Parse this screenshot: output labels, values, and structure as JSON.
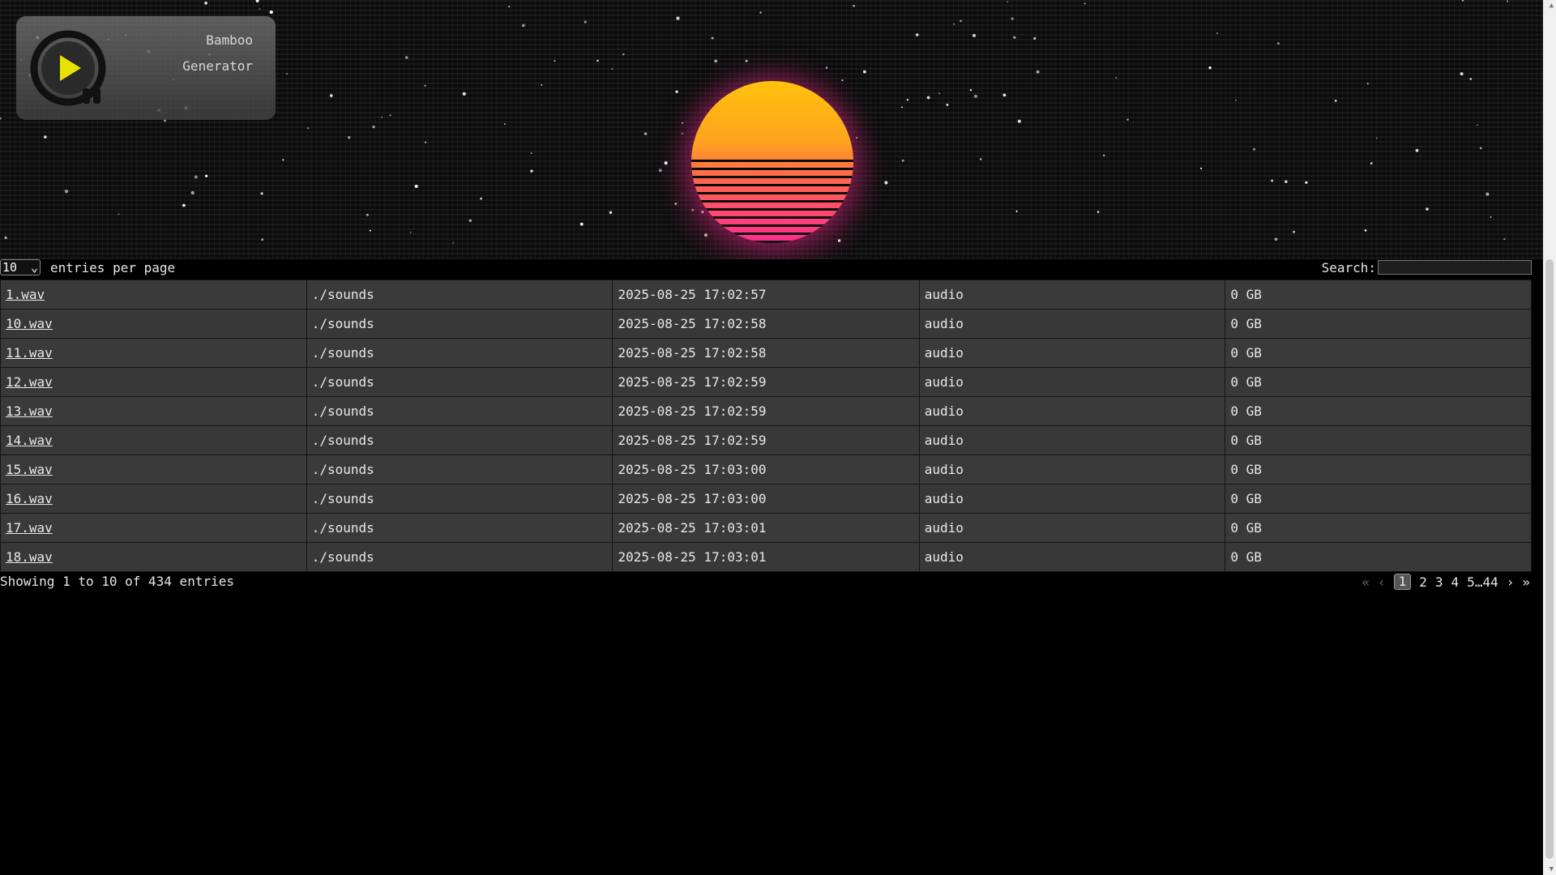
{
  "logo": {
    "line1": "Bamboo",
    "line2": "Generator",
    "icon": "play-circle-pause-icon"
  },
  "length": {
    "value": "10",
    "label": "entries per page"
  },
  "search": {
    "label": "Search:",
    "value": ""
  },
  "table": {
    "rows": [
      {
        "name": "1.wav",
        "path": "./sounds",
        "date": "2025-08-25 17:02:57",
        "type": "audio",
        "size": "0 GB"
      },
      {
        "name": "10.wav",
        "path": "./sounds",
        "date": "2025-08-25 17:02:58",
        "type": "audio",
        "size": "0 GB"
      },
      {
        "name": "11.wav",
        "path": "./sounds",
        "date": "2025-08-25 17:02:58",
        "type": "audio",
        "size": "0 GB"
      },
      {
        "name": "12.wav",
        "path": "./sounds",
        "date": "2025-08-25 17:02:59",
        "type": "audio",
        "size": "0 GB"
      },
      {
        "name": "13.wav",
        "path": "./sounds",
        "date": "2025-08-25 17:02:59",
        "type": "audio",
        "size": "0 GB"
      },
      {
        "name": "14.wav",
        "path": "./sounds",
        "date": "2025-08-25 17:02:59",
        "type": "audio",
        "size": "0 GB"
      },
      {
        "name": "15.wav",
        "path": "./sounds",
        "date": "2025-08-25 17:03:00",
        "type": "audio",
        "size": "0 GB"
      },
      {
        "name": "16.wav",
        "path": "./sounds",
        "date": "2025-08-25 17:03:00",
        "type": "audio",
        "size": "0 GB"
      },
      {
        "name": "17.wav",
        "path": "./sounds",
        "date": "2025-08-25 17:03:01",
        "type": "audio",
        "size": "0 GB"
      },
      {
        "name": "18.wav",
        "path": "./sounds",
        "date": "2025-08-25 17:03:01",
        "type": "audio",
        "size": "0 GB"
      }
    ]
  },
  "info": "Showing 1 to 10 of 434 entries",
  "pager": {
    "first": "«",
    "prev": "‹",
    "pages": [
      "1",
      "2",
      "3",
      "4",
      "5"
    ],
    "ellipsis": "…",
    "last_page": "44",
    "next": "›",
    "last": "»",
    "current": "1"
  },
  "colors": {
    "sun_top": "#ffc20d",
    "sun_bottom": "#ff2d90",
    "row_bg": "#3a3a3a",
    "page_bg": "#000000"
  }
}
